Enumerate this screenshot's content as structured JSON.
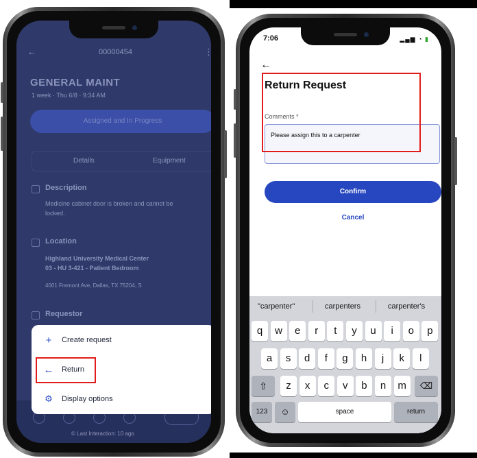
{
  "left_phone": {
    "background_screen": {
      "work_order_id": "00000454",
      "title": "GENERAL MAINT",
      "subtitle": "1 week · Thu 6/8 · 9:34 AM",
      "status_pill": "Assigned and In Progress",
      "tabs": [
        "Details",
        "Equipment"
      ],
      "description_label": "Description",
      "description_text_1": "Medicine cabinet door is broken and cannot be",
      "description_text_2": "locked.",
      "location_label": "Location",
      "location_name_1": "Highland University Medical Center",
      "location_name_2": "03 - HU 3-421 - Patient Bedroom",
      "location_address": "4001 Fremont Ave, Dallas, TX 75204, S",
      "requestor_label": "Requestor",
      "footer_text": "© Last Interaction: 10 ago"
    },
    "action_sheet": {
      "items": [
        {
          "icon": "plus-icon",
          "label": "Create request"
        },
        {
          "icon": "arrow-left-icon",
          "label": "Return"
        },
        {
          "icon": "gear-icon",
          "label": "Display options"
        }
      ]
    }
  },
  "right_phone": {
    "status_bar": {
      "time": "7:06"
    },
    "page_title": "Return Request",
    "comments": {
      "label": "Comments *",
      "value": "Please assign this to a carpenter"
    },
    "confirm_label": "Confirm",
    "cancel_label": "Cancel",
    "keyboard": {
      "suggestions": [
        "\"carpenter\"",
        "carpenters",
        "carpenter's"
      ],
      "row1": [
        "q",
        "w",
        "e",
        "r",
        "t",
        "y",
        "u",
        "i",
        "o",
        "p"
      ],
      "row2": [
        "a",
        "s",
        "d",
        "f",
        "g",
        "h",
        "j",
        "k",
        "l"
      ],
      "row3": [
        "z",
        "x",
        "c",
        "v",
        "b",
        "n",
        "m"
      ],
      "numbers_label": "123",
      "space_label": "space",
      "return_label": "return"
    }
  },
  "colors": {
    "accent": "#2747c0",
    "highlight": "#e21b1b",
    "overlay": "#2f3a6a"
  }
}
